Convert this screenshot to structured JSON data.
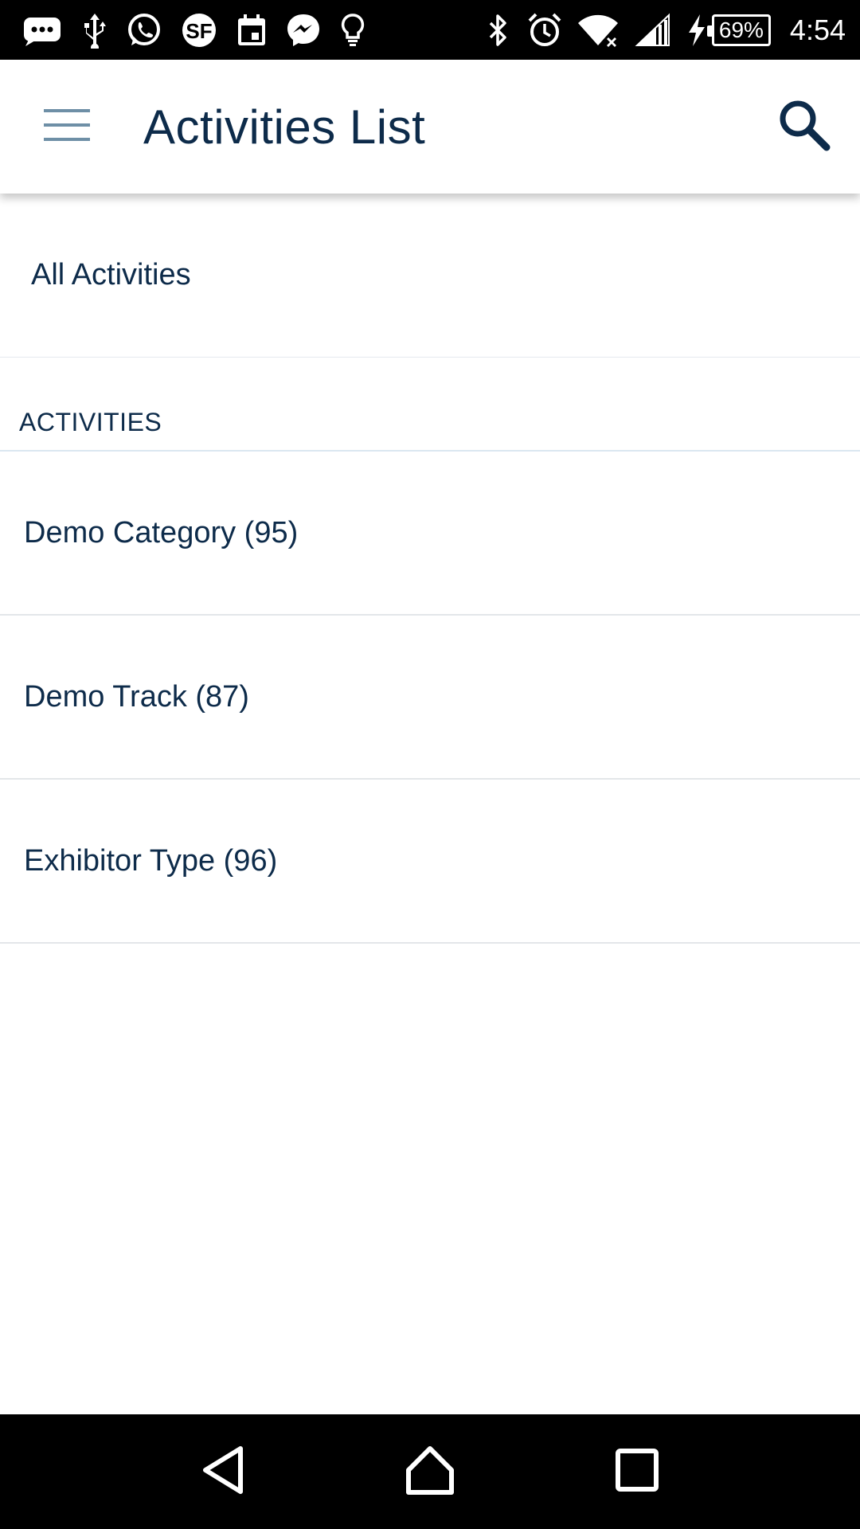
{
  "status_bar": {
    "notification_icons": [
      "message-icon",
      "usb-icon",
      "whatsapp-icon",
      "sf-icon",
      "calendar-icon",
      "messenger-icon",
      "bulb-icon"
    ],
    "system_icons": [
      "bluetooth-icon",
      "alarm-icon",
      "wifi-icon",
      "signal-icon",
      "charging-icon"
    ],
    "battery": "69%",
    "time": "4:54"
  },
  "app_bar": {
    "title": "Activities List",
    "menu_icon": "hamburger-menu-icon",
    "search_icon": "search-icon"
  },
  "main": {
    "all_activities_label": "All Activities",
    "section_header": "ACTIVITIES",
    "categories": [
      {
        "label": "Demo Category (95)"
      },
      {
        "label": "Demo Track (87)"
      },
      {
        "label": "Exhibitor Type (96)"
      }
    ]
  },
  "nav_bar": {
    "buttons": [
      "back-icon",
      "home-icon",
      "recents-icon"
    ]
  },
  "colors": {
    "text": "#0d2b4a",
    "menu_icon": "#6e8fa6",
    "divider": "#e3e6e9",
    "section_divider": "#dbe7f1"
  }
}
